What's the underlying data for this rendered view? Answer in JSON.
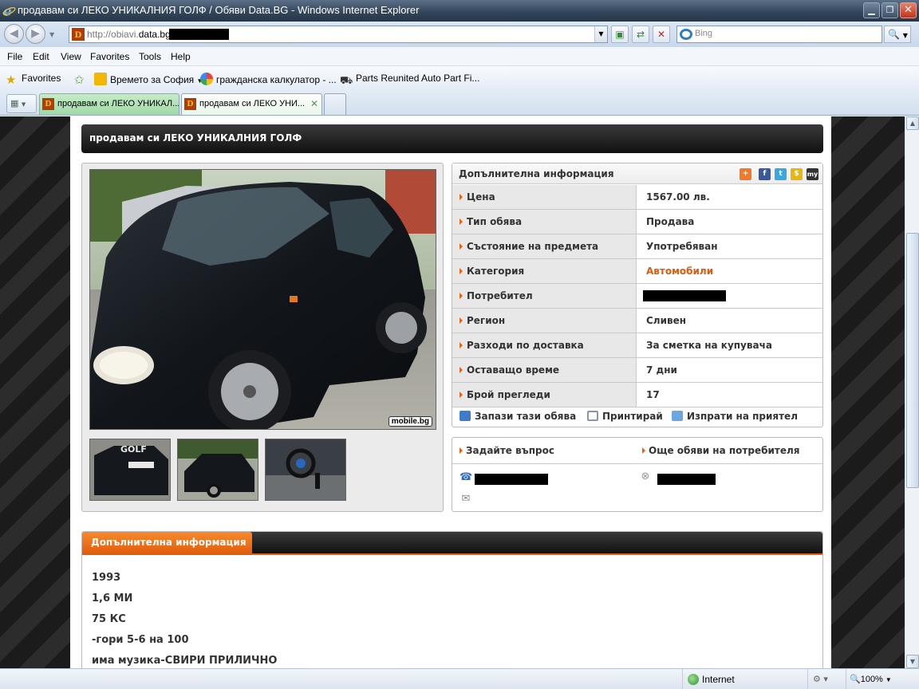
{
  "window": {
    "title": "продавам си ЛЕКО УНИКАЛНИЯ ГОЛФ / Обяви Data.BG - Windows Internet Explorer",
    "minimize_glyph": "▁",
    "restore_glyph": "❐",
    "close_glyph": "✕"
  },
  "address": {
    "url_prefix": "http://obiavi.",
    "url_domain": "data.bg",
    "search_placeholder": "Bing"
  },
  "menu": [
    "File",
    "Edit",
    "View",
    "Favorites",
    "Tools",
    "Help"
  ],
  "favorites_bar": {
    "favorites_label": "Favorites",
    "links": [
      "Времето за София",
      "гражданска калкулатор - ...",
      "Parts Reunited Auto Part Fi..."
    ]
  },
  "tabs": [
    {
      "label": "продавам си ЛЕКО УНИКАЛ...",
      "active": false
    },
    {
      "label": "продавам си ЛЕКО УНИ...",
      "active": true
    }
  ],
  "ad": {
    "title": "продавам си ЛЕКО УНИКАЛНИЯ ГОЛФ",
    "photo_watermark": "mobile.bg",
    "info_header": "Допълнителна информация",
    "share_icons": [
      "plus-share-icon",
      "facebook-icon",
      "twitter-icon",
      "delicious-icon",
      "myspace-icon"
    ],
    "details": [
      {
        "label": "Цена",
        "value": "1567.00 лв."
      },
      {
        "label": "Тип обява",
        "value": "Продава"
      },
      {
        "label": "Състояние на предмета",
        "value": "Употребяван"
      },
      {
        "label": "Категория",
        "value": "Автомобили"
      },
      {
        "label": "Потребител",
        "value": ""
      },
      {
        "label": "Регион",
        "value": "Сливен"
      },
      {
        "label": "Разходи по доставка",
        "value": "За сметка на купувача"
      },
      {
        "label": "Оставащо време",
        "value": "7 дни"
      },
      {
        "label": "Брой прегледи",
        "value": "17"
      }
    ],
    "actions": {
      "save": "Запази тази обява",
      "print": "Принтирай",
      "send": "Изпрати на приятел"
    },
    "contact": {
      "ask": "Задайте въпрос",
      "more_ads": "Още обяви на потребителя"
    },
    "description": {
      "tab": "Допълнителна информация",
      "lines": [
        "1993",
        "1,6 МИ",
        "75 КС",
        "-гори 5-6 на 100",
        "има музика-СВИРИ ПРИЛИЧНО"
      ]
    }
  },
  "status": {
    "zone": "Internet",
    "zoom": "100%"
  },
  "colors": {
    "accent_orange": "#e05a0b",
    "dark_header": "#1a1a1a",
    "tab_green": "#9fd8a5"
  }
}
